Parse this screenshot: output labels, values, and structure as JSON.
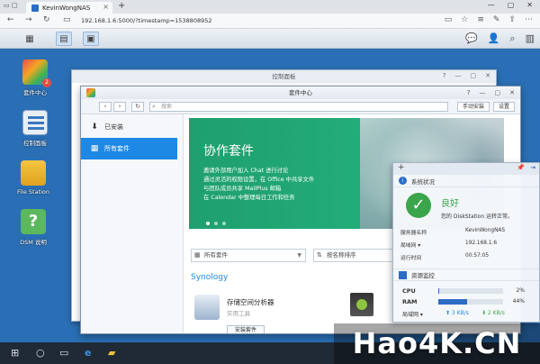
{
  "browser": {
    "tab_title": "KevinWongNAS",
    "url": "192.168.1.6:5000/?timestamp=1538808952",
    "new_tab": "+",
    "close": "×"
  },
  "desktop_icons": [
    {
      "label": "套件中心",
      "badge": "2",
      "icon": "package-icon"
    },
    {
      "label": "控制面板",
      "icon": "control-panel-icon"
    },
    {
      "label": "File Station",
      "icon": "folder-icon"
    },
    {
      "label": "DSM 说明",
      "icon": "help-icon"
    }
  ],
  "control_panel": {
    "title": "控制面板"
  },
  "package_center": {
    "title": "套件中心",
    "search_placeholder": "搜索",
    "manual_install": "手动安装",
    "settings": "设置",
    "sidebar": [
      {
        "label": "已安装",
        "icon": "download-icon"
      },
      {
        "label": "所有套件",
        "icon": "grid-icon"
      }
    ],
    "banner": {
      "title": "协作套件",
      "lines": [
        "邀请外部用户加入 Chat 进行讨论",
        "通过灵活的权限设置，在 Office 中共享文件",
        "与团队成员共享 MailPlus 邮箱",
        "在 Calendar 中整理每日工作和任务"
      ]
    },
    "filter_category": "所有套件",
    "filter_sort": "按名称排序",
    "section_title": "Synology",
    "app": {
      "name": "存储空间分析器",
      "category": "实用工具",
      "install": "安装套件"
    }
  },
  "widget": {
    "system_status_title": "系统状况",
    "status": "良好",
    "status_desc": "您的 DiskStation 运转正常。",
    "rows": [
      {
        "key": "服务器名称",
        "value": "KevinWongNAS"
      },
      {
        "key": "局域网 ▾",
        "value": "192.168.1.6"
      },
      {
        "key": "运行时间",
        "value": "00:57:05"
      }
    ],
    "resource_title": "资源监控",
    "cpu_label": "CPU",
    "cpu_pct": "2%",
    "cpu_value": 2,
    "ram_label": "RAM",
    "ram_pct": "44%",
    "ram_value": 44,
    "net_label": "局域网 ▾",
    "net_up": "⬆ 3 KB/s",
    "net_down": "⬇ 2 KB/s"
  },
  "watermark": "Hao4K.CN"
}
